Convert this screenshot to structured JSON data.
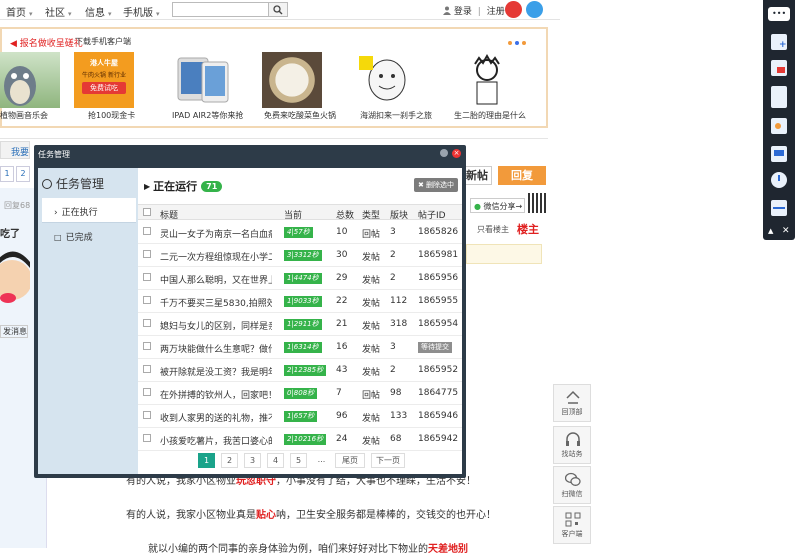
{
  "topnav": {
    "items": [
      {
        "label": "首页",
        "caret": "▾"
      },
      {
        "label": "社区",
        "caret": "▾"
      },
      {
        "label": "信息",
        "caret": "▾"
      },
      {
        "label": "手机版",
        "caret": "▾"
      }
    ],
    "search_value": "",
    "login": "登录",
    "sep": "|",
    "register": "注册"
  },
  "banner": {
    "red_text": "报名做收呈磋礼",
    "download_text": "下载手机客户端",
    "items": [
      {
        "caption": "植物画音乐会"
      },
      {
        "caption": "抢100现金卡",
        "overlay": [
          "港人牛屋",
          "牛肉火锅 新行业",
          "免费试吃"
        ]
      },
      {
        "caption": "IPAD AIR2等你来抢"
      },
      {
        "caption": "免费来吃酸菜鱼火锅"
      },
      {
        "caption": "海湖扣来一刹手之旅"
      },
      {
        "caption": "生二胎的理由是什么"
      }
    ]
  },
  "background": {
    "fayin": "我要",
    "pages": [
      "1",
      "2"
    ],
    "huifu": "回复68",
    "chi": "吃了",
    "send_msg": "发消息",
    "post_btn": "新帖",
    "reply_btn": "回复",
    "share": "微信分享→",
    "only_op": "只看楼主",
    "louzhu": "楼主",
    "para1": {
      "pre": "有的人说，我家小区物业",
      "red1": "玩忽职守",
      "mid": "，小事没有了结，大事也不理睬，生活不安！",
      "red2": ""
    },
    "para2": {
      "pre": "有的人说，我家小区物业真是",
      "red1": "贴心",
      "mid": "呐，卫生安全服务都是棒棒的，交钱交的也开心！",
      "red2": ""
    },
    "para3": {
      "pre": "就以小编的两个同事的亲身体验为例，咱们来好好对比下物业的",
      "red1": "天差地别",
      "mid": "",
      "red2": ""
    }
  },
  "float_buttons": [
    {
      "label": "回顶部",
      "icon": "arrow-up-icon"
    },
    {
      "label": "找站务",
      "icon": "headset-icon"
    },
    {
      "label": "扫微信",
      "icon": "wechat-icon"
    },
    {
      "label": "客户端",
      "icon": "qrcode-icon"
    }
  ],
  "toolbar": {
    "icons": [
      "chat-icon",
      "plus-doc-icon",
      "image-doc-icon",
      "grid-doc-icon",
      "edit-icon",
      "profile-icon",
      "monitor-icon",
      "clock-icon",
      "bar-icon"
    ],
    "foot_up": "▲",
    "foot_close": "✕"
  },
  "dialog": {
    "title": "任务管理",
    "close": "×",
    "side": {
      "heading": "任务管理",
      "items": [
        {
          "label": "正在执行",
          "mark": "›",
          "active": true
        },
        {
          "label": "已完成",
          "mark": "□",
          "active": false
        }
      ]
    },
    "main": {
      "heading": "正在运行",
      "count": "71",
      "delete_btn": "✖ 删除选中",
      "columns": {
        "title": "标题",
        "current": "当前",
        "total": "总数",
        "type": "类型",
        "section": "版块",
        "id": "帖子ID"
      },
      "rows": [
        {
          "title": "灵山一女子为南京一名白血病",
          "current": "4|57秒",
          "status": "green",
          "total": "10",
          "type": "回帖",
          "section": "3",
          "id": "1865826"
        },
        {
          "title": "二元一次方程组惊现在小学二",
          "current": "3|3312秒",
          "status": "green",
          "total": "30",
          "type": "发帖",
          "section": "2",
          "id": "1865981"
        },
        {
          "title": "中国人那么聪明，又在世界上",
          "current": "1|4474秒",
          "status": "green",
          "total": "29",
          "type": "发帖",
          "section": "2",
          "id": "1865956"
        },
        {
          "title": "千万不要买三星5830,拍照效果",
          "current": "1|9033秒",
          "status": "green",
          "total": "22",
          "type": "发帖",
          "section": "112",
          "id": "1865955"
        },
        {
          "title": "媳妇与女儿的区别，同样是亲",
          "current": "1|2911秒",
          "status": "green",
          "total": "21",
          "type": "发帖",
          "section": "318",
          "id": "1865954"
        },
        {
          "title": "两万块能做什么生意呢？做什",
          "current": "1|6314秒",
          "status": "green",
          "total": "16",
          "type": "发帖",
          "section": "3",
          "id": "等待提交"
        },
        {
          "title": "被开除就是没工资？我是明年",
          "current": "2|12385秒",
          "status": "green",
          "total": "43",
          "type": "发帖",
          "section": "2",
          "id": "1865952"
        },
        {
          "title": "在外拼搏的钦州人，回家吧！",
          "current": "0|808秒",
          "status": "green",
          "total": "7",
          "type": "回帖",
          "section": "98",
          "id": "1864775"
        },
        {
          "title": "收到人家男的送的礼物，推不",
          "current": "1|657秒",
          "status": "green",
          "total": "96",
          "type": "发帖",
          "section": "133",
          "id": "1865946"
        },
        {
          "title": "小孩爱吃薯片，我苦口婆心的",
          "current": "2|10216秒",
          "status": "green",
          "total": "24",
          "type": "发帖",
          "section": "68",
          "id": "1865942"
        }
      ],
      "pager": {
        "pages": [
          "1",
          "2",
          "3",
          "4",
          "5"
        ],
        "ellipsis": "...",
        "prev": "尾页",
        "next": "下一页"
      }
    }
  },
  "colors": {
    "accent_green": "#35b34a",
    "reply_orange": "#f29a3b",
    "dialog_dark": "#2d3b48",
    "side_blue": "#d6e4ef"
  }
}
